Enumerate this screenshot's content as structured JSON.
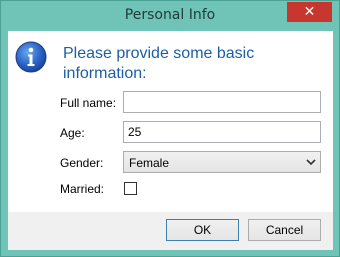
{
  "window": {
    "title": "Personal Info",
    "close_label": "✕"
  },
  "dialog": {
    "heading": "Please provide some basic information:",
    "icon": "info-icon"
  },
  "form": {
    "full_name": {
      "label": "Full name:",
      "value": ""
    },
    "age": {
      "label": "Age:",
      "value": "25"
    },
    "gender": {
      "label": "Gender:",
      "value": "Female"
    },
    "married": {
      "label": "Married:",
      "checked": false
    }
  },
  "buttons": {
    "ok_label": "OK",
    "cancel_label": "Cancel"
  },
  "colors": {
    "frame": "#6fc3b7",
    "heading": "#1d5ea3",
    "close": "#c7372f"
  }
}
